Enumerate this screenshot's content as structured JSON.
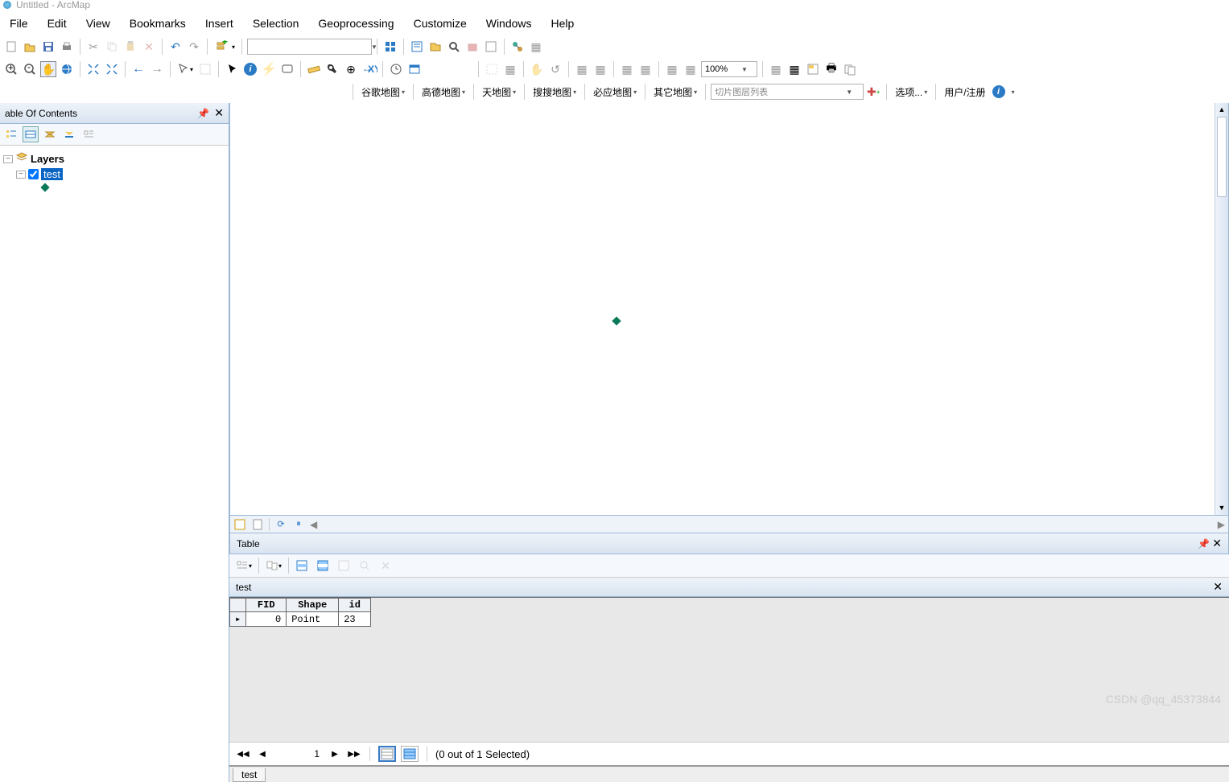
{
  "window": {
    "title": "Untitled - ArcMap"
  },
  "menu": {
    "items": [
      "File",
      "Edit",
      "View",
      "Bookmarks",
      "Insert",
      "Selection",
      "Geoprocessing",
      "Customize",
      "Windows",
      "Help"
    ]
  },
  "toolbars": {
    "scale_combo": "",
    "zoom_combo": "100%"
  },
  "mapserv": {
    "items": [
      "谷歌地图",
      "高德地图",
      "天地图",
      "搜搜地图",
      "必应地图",
      "其它地图"
    ],
    "combo_label": "切片图层列表",
    "options": "选项...",
    "user": "用户/注册"
  },
  "toc": {
    "title": "able Of Contents",
    "root_label": "Layers",
    "layer": {
      "name": "test",
      "checked": true
    }
  },
  "table": {
    "panel_title": "Table",
    "tab_name": "test",
    "columns": [
      "FID",
      "Shape",
      "id"
    ],
    "rows": [
      {
        "FID": 0,
        "Shape": "Point",
        "id": 23
      }
    ],
    "nav": {
      "current": "1",
      "selection_text": "(0 out of 1 Selected)"
    },
    "bottom_tab": "test"
  },
  "watermark": "CSDN @qq_45373844"
}
